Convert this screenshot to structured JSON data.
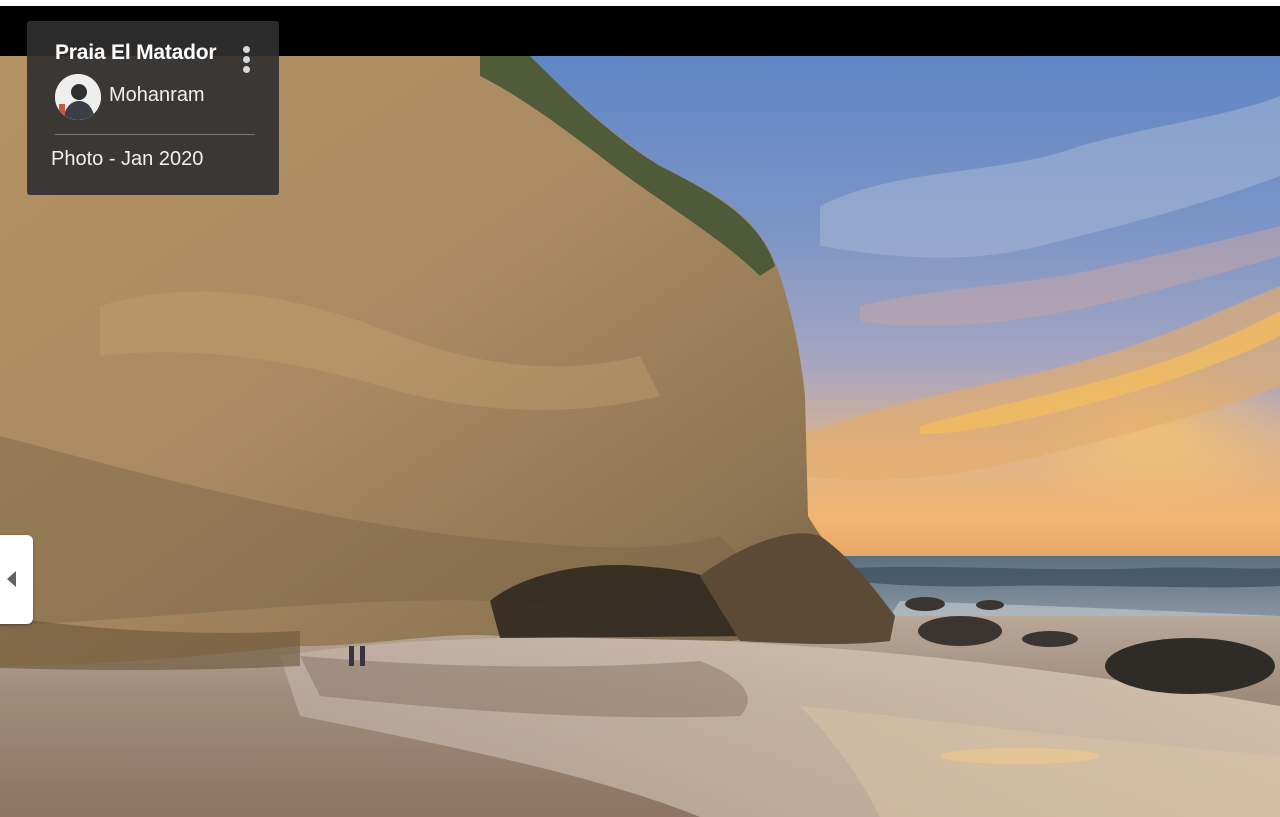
{
  "place": {
    "title": "Praia El Matador"
  },
  "author": {
    "name": "Mohanram",
    "avatar_icon": "user-avatar"
  },
  "photo": {
    "date_label": "Photo - Jan 2020",
    "subject": "beach-cliff-sunset-image"
  },
  "controls": {
    "more_icon": "more-vert-icon",
    "prev_icon": "chevron-left-icon"
  },
  "colors": {
    "card_background": "#303030",
    "top_bar": "#000000",
    "nav_button": "#ffffff"
  }
}
